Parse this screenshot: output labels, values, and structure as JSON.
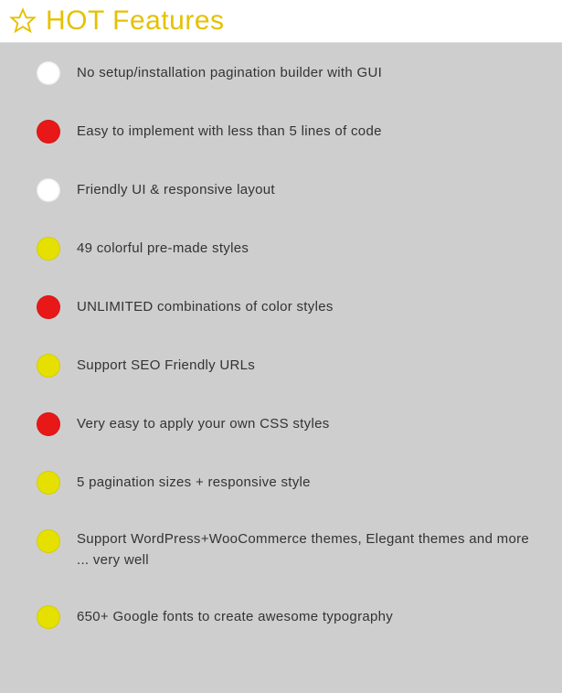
{
  "header": {
    "title": "HOT Features"
  },
  "features": {
    "item0": {
      "text": "No setup/installation pagination builder with GUI",
      "color": "white"
    },
    "item1": {
      "text": "Easy to implement with less than 5 lines of code",
      "color": "red"
    },
    "item2": {
      "text": "Friendly UI & responsive layout",
      "color": "white"
    },
    "item3": {
      "text": "49 colorful pre-made styles",
      "color": "yellow"
    },
    "item4": {
      "text": "UNLIMITED combinations of color styles",
      "color": "red"
    },
    "item5": {
      "text": "Support SEO Friendly URLs",
      "color": "yellow"
    },
    "item6": {
      "text": "Very easy to apply your own CSS styles",
      "color": "red"
    },
    "item7": {
      "text": "5 pagination sizes + responsive style",
      "color": "yellow"
    },
    "item8": {
      "text": "Support WordPress+WooCommerce themes, Elegant themes and more ... very well",
      "color": "yellow"
    },
    "item9": {
      "text": "650+ Google fonts to create awesome typography",
      "color": "yellow"
    }
  }
}
